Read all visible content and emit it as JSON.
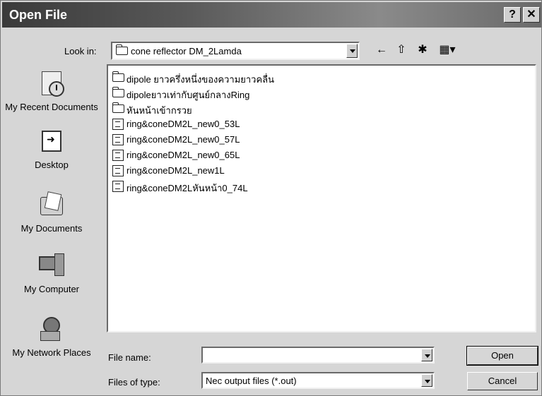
{
  "window": {
    "title": "Open File",
    "help_label": "?",
    "close_label": "✕"
  },
  "lookin": {
    "label": "Look in:",
    "value": "cone reflector DM_2Lamda"
  },
  "toolbar": {
    "back_icon": "←",
    "up_icon": "⇧",
    "new_folder_icon": "✱",
    "view_menu_icon": "▦▾"
  },
  "places": [
    {
      "label": "My Recent Documents",
      "icon": "recent-documents-icon"
    },
    {
      "label": "Desktop",
      "icon": "desktop-icon"
    },
    {
      "label": "My Documents",
      "icon": "my-documents-icon"
    },
    {
      "label": "My Computer",
      "icon": "my-computer-icon"
    },
    {
      "label": "My Network Places",
      "icon": "network-places-icon"
    }
  ],
  "files": [
    {
      "name": "dipole ยาวครึ่งหนึ่งของความยาวคลื่น",
      "type": "folder"
    },
    {
      "name": "dipoleยาวเท่ากับศูนย์กลางRing",
      "type": "folder"
    },
    {
      "name": "หันหน้าเข้ากรวย",
      "type": "folder"
    },
    {
      "name": "ring&coneDM2L_new0_53L",
      "type": "file"
    },
    {
      "name": "ring&coneDM2L_new0_57L",
      "type": "file"
    },
    {
      "name": "ring&coneDM2L_new0_65L",
      "type": "file"
    },
    {
      "name": "ring&coneDM2L_new1L",
      "type": "file"
    },
    {
      "name": "ring&coneDM2Lหันหน้า0_74L",
      "type": "file"
    }
  ],
  "filename": {
    "label": "File name:",
    "value": ""
  },
  "filetype": {
    "label": "Files of type:",
    "value": "Nec output files (*.out)"
  },
  "buttons": {
    "open": "Open",
    "cancel": "Cancel"
  }
}
